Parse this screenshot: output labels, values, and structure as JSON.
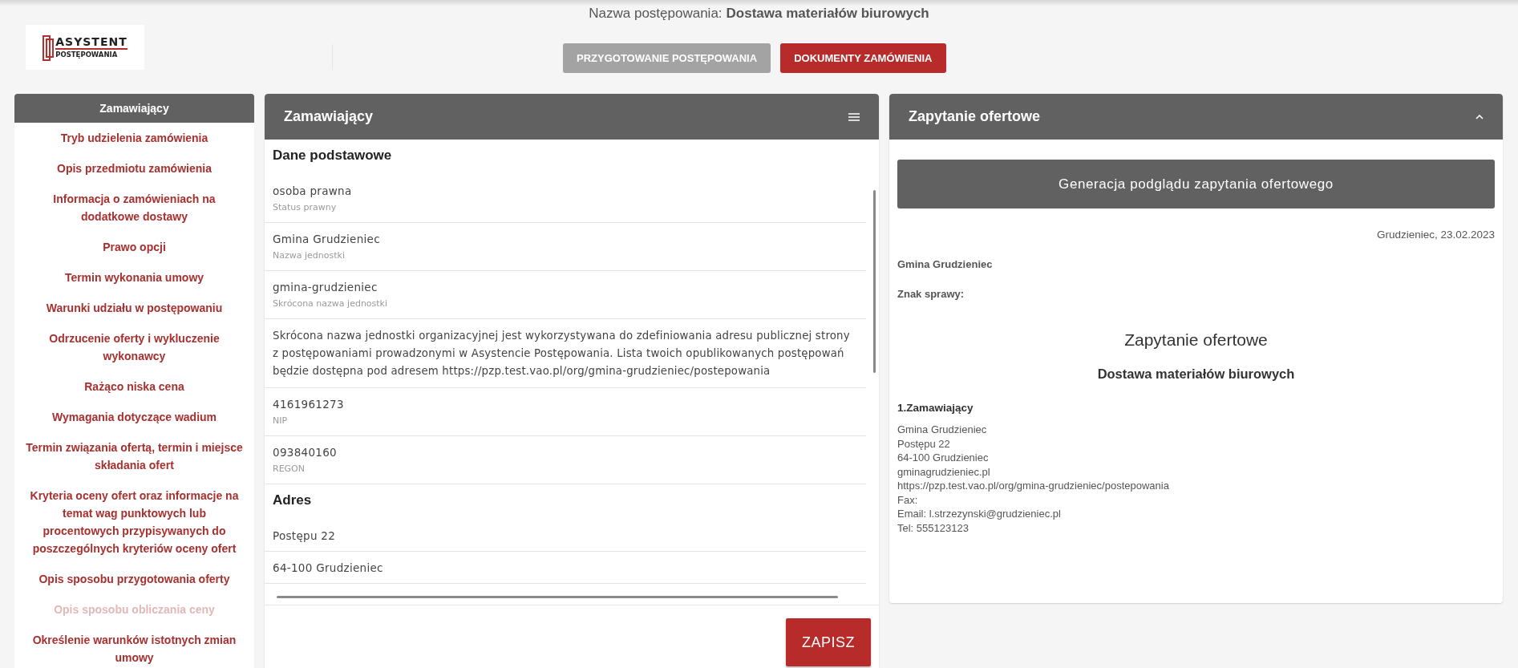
{
  "procedure": {
    "label": "Nazwa postępowania:",
    "name": "Dostawa materiałów biurowych"
  },
  "logo": {
    "line1": "ASYSTENT",
    "line2": "POSTĘPOWANIA"
  },
  "nav_buttons": [
    {
      "label": "PRZYGOTOWANIE POSTĘPOWANIA",
      "selected": false
    },
    {
      "label": "DOKUMENTY ZAMÓWIENIA",
      "selected": true
    }
  ],
  "sidebar": {
    "items": [
      {
        "label": "Zamawiający",
        "selected": true,
        "disabled": false
      },
      {
        "label": "Tryb udzielenia zamówienia",
        "selected": false,
        "disabled": false
      },
      {
        "label": "Opis przedmiotu zamówienia",
        "selected": false,
        "disabled": false
      },
      {
        "label": "Informacja o zamówieniach na dodatkowe dostawy",
        "selected": false,
        "disabled": false
      },
      {
        "label": "Prawo opcji",
        "selected": false,
        "disabled": false
      },
      {
        "label": "Termin wykonania umowy",
        "selected": false,
        "disabled": false
      },
      {
        "label": "Warunki udziału w postępowaniu",
        "selected": false,
        "disabled": false
      },
      {
        "label": "Odrzucenie oferty i wykluczenie wykonawcy",
        "selected": false,
        "disabled": false
      },
      {
        "label": "Rażąco niska cena",
        "selected": false,
        "disabled": false
      },
      {
        "label": "Wymagania dotyczące wadium",
        "selected": false,
        "disabled": false
      },
      {
        "label": "Termin związania ofertą, termin i miejsce składania ofert",
        "selected": false,
        "disabled": false
      },
      {
        "label": "Kryteria oceny ofert oraz informacje na temat wag punktowych lub procentowych przypisywanych do poszczególnych kryteriów oceny ofert",
        "selected": false,
        "disabled": false
      },
      {
        "label": "Opis sposobu przygotowania oferty",
        "selected": false,
        "disabled": false
      },
      {
        "label": "Opis sposobu obliczania ceny",
        "selected": false,
        "disabled": true
      },
      {
        "label": "Określenie warunków istotnych zmian umowy",
        "selected": false,
        "disabled": false
      }
    ]
  },
  "form_panel": {
    "title": "Zamawiający",
    "sections": [
      {
        "title": "Dane podstawowe",
        "rows": [
          {
            "kind": "field",
            "value": "osoba prawna",
            "label": "Status prawny"
          },
          {
            "kind": "field",
            "value": "Gmina Grudzieniec",
            "label": "Nazwa jednostki"
          },
          {
            "kind": "field",
            "value": "gmina-grudzieniec",
            "label": "Skrócona nazwa jednostki"
          },
          {
            "kind": "note",
            "text": "Skrócona nazwa jednostki organizacyjnej jest wykorzystywana do zdefiniowania adresu publicznej strony z postępowaniami prowadzonymi w Asystencie Postępowania. Lista twoich opublikowanych postępowań będzie dostępna pod adresem https://pzp.test.vao.pl/org/gmina-grudzieniec/postepowania"
          },
          {
            "kind": "field",
            "value": "4161961273",
            "label": "NIP"
          },
          {
            "kind": "field",
            "value": "093840160",
            "label": "REGON"
          }
        ]
      },
      {
        "title": "Adres",
        "rows": [
          {
            "kind": "field",
            "value": "Postępu 22"
          },
          {
            "kind": "field",
            "value": "64-100 Grudzieniec"
          }
        ]
      }
    ],
    "save_button": "ZAPISZ"
  },
  "preview_panel": {
    "title": "Zapytanie ofertowe",
    "expanded": true,
    "generate_button": "Generacja podglądu zapytania ofertowego",
    "date": "Grudzieniec, 23.02.2023",
    "recipient": "Gmina Grudzieniec",
    "case_ref": "Znak sprawy:",
    "doc_title": "Zapytanie ofertowe",
    "doc_subtitle": "Dostawa materiałów biurowych",
    "section_title": "1.Zamawiający",
    "section_lines": [
      "Gmina Grudzieniec",
      "Postępu 22",
      "64-100 Grudzieniec",
      "gminagrudzieniec.pl",
      "https://pzp.test.vao.pl/org/gmina-grudzieniec/postepowania",
      "Fax:",
      "Email: l.strzezynski@grudzieniec.pl",
      "Tel: 555123123"
    ]
  }
}
